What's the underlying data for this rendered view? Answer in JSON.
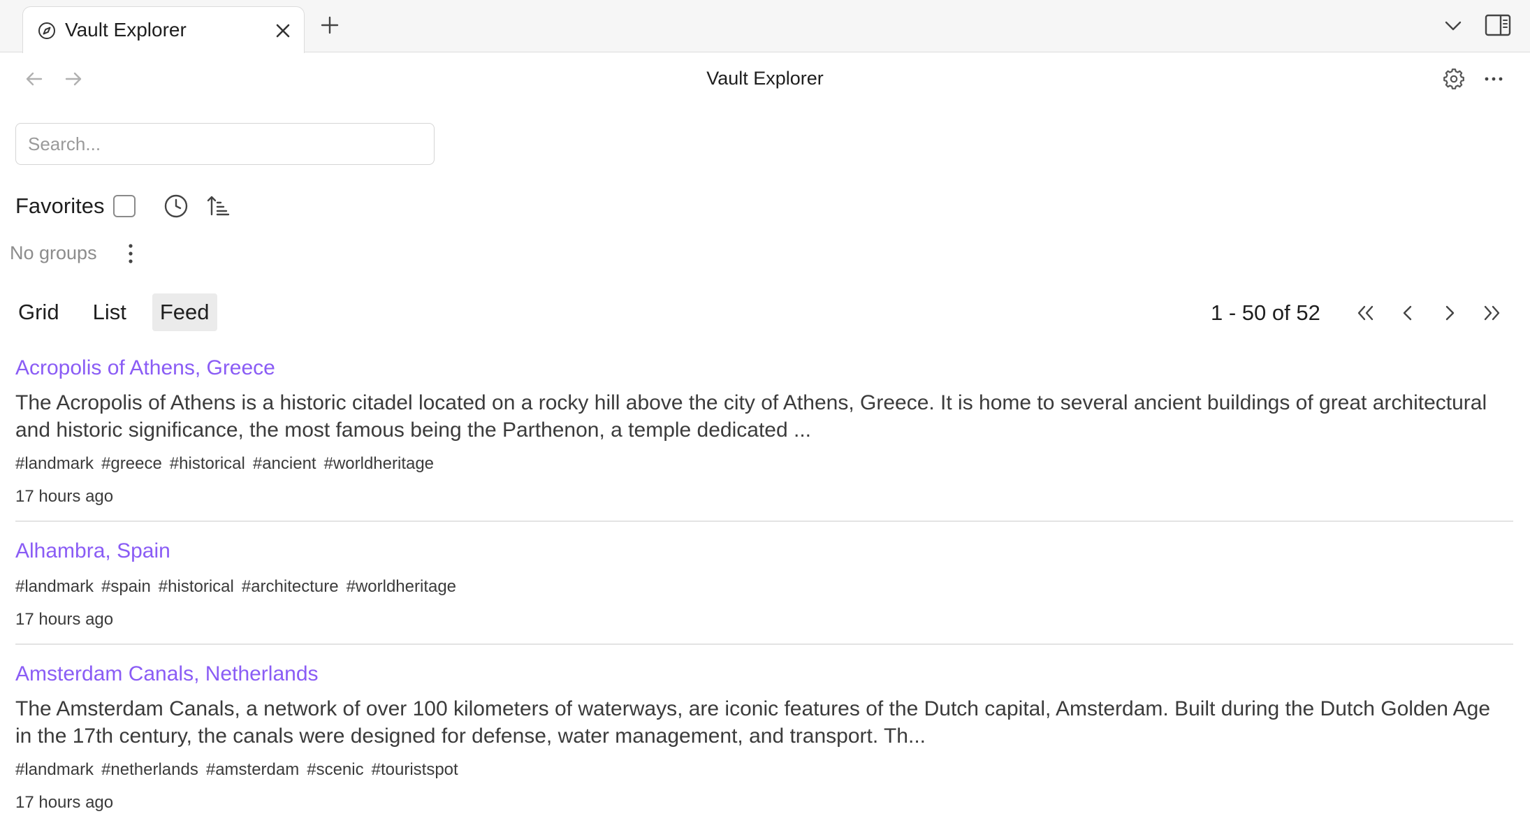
{
  "tab": {
    "title": "Vault Explorer",
    "icon": "compass-icon"
  },
  "header": {
    "title": "Vault Explorer"
  },
  "search": {
    "placeholder": "Search...",
    "value": ""
  },
  "filters": {
    "favorites_label": "Favorites",
    "favorites_checked": false,
    "no_groups_label": "No groups"
  },
  "view_tabs": [
    {
      "label": "Grid",
      "active": false
    },
    {
      "label": "List",
      "active": false
    },
    {
      "label": "Feed",
      "active": true
    }
  ],
  "pagination": {
    "info": "1 - 50 of 52"
  },
  "feed": {
    "items": [
      {
        "title": "Acropolis of Athens, Greece",
        "excerpt": "The Acropolis of Athens is a historic citadel located on a rocky hill above the city of Athens, Greece. It is home to several ancient buildings of great architectural and historic significance, the most famous being the Parthenon, a temple dedicated ...",
        "tags": [
          "#landmark",
          "#greece",
          "#historical",
          "#ancient",
          "#worldheritage"
        ],
        "time": "17 hours ago"
      },
      {
        "title": "Alhambra, Spain",
        "excerpt": "",
        "tags": [
          "#landmark",
          "#spain",
          "#historical",
          "#architecture",
          "#worldheritage"
        ],
        "time": "17 hours ago"
      },
      {
        "title": "Amsterdam Canals, Netherlands",
        "excerpt": "The Amsterdam Canals, a network of over 100 kilometers of waterways, are iconic features of the Dutch capital, Amsterdam. Built during the Dutch Golden Age in the 17th century, the canals were designed for defense, water management, and transport. Th...",
        "tags": [
          "#landmark",
          "#netherlands",
          "#amsterdam",
          "#scenic",
          "#touristspot"
        ],
        "time": "17 hours ago"
      }
    ]
  },
  "colors": {
    "link": "#8a5cf5",
    "text": "#3b3b3b",
    "muted": "#8c8c8c",
    "active_tab_bg": "#ebebeb",
    "divider": "#e3e3e3"
  }
}
